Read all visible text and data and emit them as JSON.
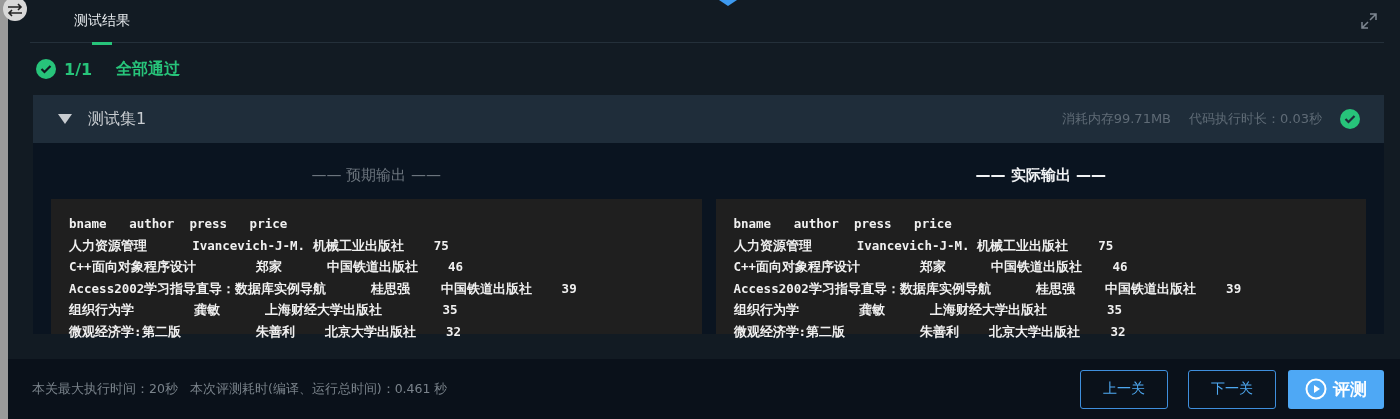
{
  "tabs": [
    {
      "label": "测试结果",
      "selected": true
    }
  ],
  "summary": {
    "passed": true,
    "count": "1/1",
    "text": "全部通过"
  },
  "test_sets": [
    {
      "title": "测试集1",
      "expanded": true,
      "passed": true,
      "memory": "消耗内存99.71MB",
      "duration": "代码执行时长：0.03秒",
      "outputs": [
        {
          "title": "—— 预期输出 ——",
          "selected": false,
          "lines": [
            "bname   author  press   price",
            "人力资源管理      Ivancevich-J-M. 机械工业出版社    75",
            "C++面向对象程序设计        郑家      中国铁道出版社    46",
            "Access2002学习指导直导：数据库实例导航      桂思强    中国铁道出版社    39",
            "组织行为学        龚敏      上海财经大学出版社        35",
            "微观经济学:第二版          朱善利    北京大学出版社    32"
          ]
        },
        {
          "title": "—— 实际输出 ——",
          "selected": true,
          "lines": [
            "bname   author  press   price",
            "人力资源管理      Ivancevich-J-M. 机械工业出版社    75",
            "C++面向对象程序设计        郑家      中国铁道出版社    46",
            "Access2002学习指导直导：数据库实例导航      桂思强    中国铁道出版社    39",
            "组织行为学        龚敏      上海财经大学出版社        35",
            "微观经济学:第二版          朱善利    北京大学出版社    32"
          ]
        }
      ]
    }
  ],
  "footer": {
    "max_time": "本关最大执行时间：20秒",
    "eval_time": "本次评测耗时(编译、运行总时间)：0.461 秒"
  },
  "buttons": [
    {
      "label": "上一关",
      "kind": "outline"
    },
    {
      "label": "下一关",
      "kind": "outline"
    },
    {
      "label": "评测",
      "kind": "primary"
    }
  ]
}
